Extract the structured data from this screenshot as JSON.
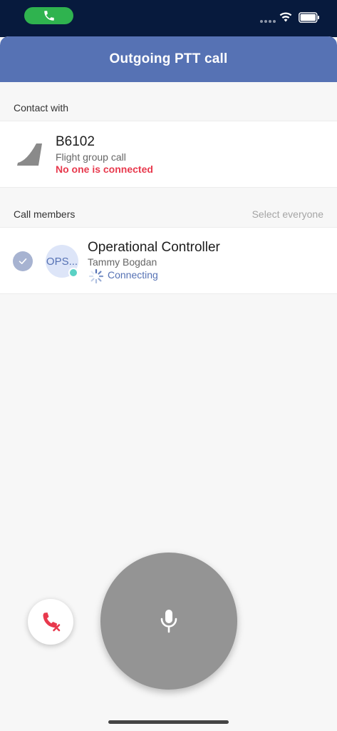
{
  "header": {
    "title": "Outgoing PTT call"
  },
  "contact_section": {
    "label": "Contact with"
  },
  "contact": {
    "name": "B6102",
    "subtitle": "Flight group call",
    "status": "No one is connected"
  },
  "members_section": {
    "label": "Call members",
    "select_all_label": "Select everyone"
  },
  "members": [
    {
      "avatar_text": "OPS...",
      "name": "Operational Controller",
      "person": "Tammy Bogdan",
      "status": "Connecting",
      "selected": true
    }
  ],
  "icons": {
    "status_call": "phone-icon",
    "wifi": "wifi-icon",
    "battery": "battery-icon",
    "contact": "plane-tail-icon",
    "check": "checkmark-icon",
    "spinner": "loading-spinner-icon",
    "hangup": "hang-up-icon",
    "ptt": "microphone-icon"
  },
  "colors": {
    "accent": "#5672b4",
    "status_bar": "#071a3d",
    "call_pill": "#2fb34f",
    "error": "#e8394d",
    "ptt_button": "#949494",
    "presence": "#5ad1c4"
  }
}
